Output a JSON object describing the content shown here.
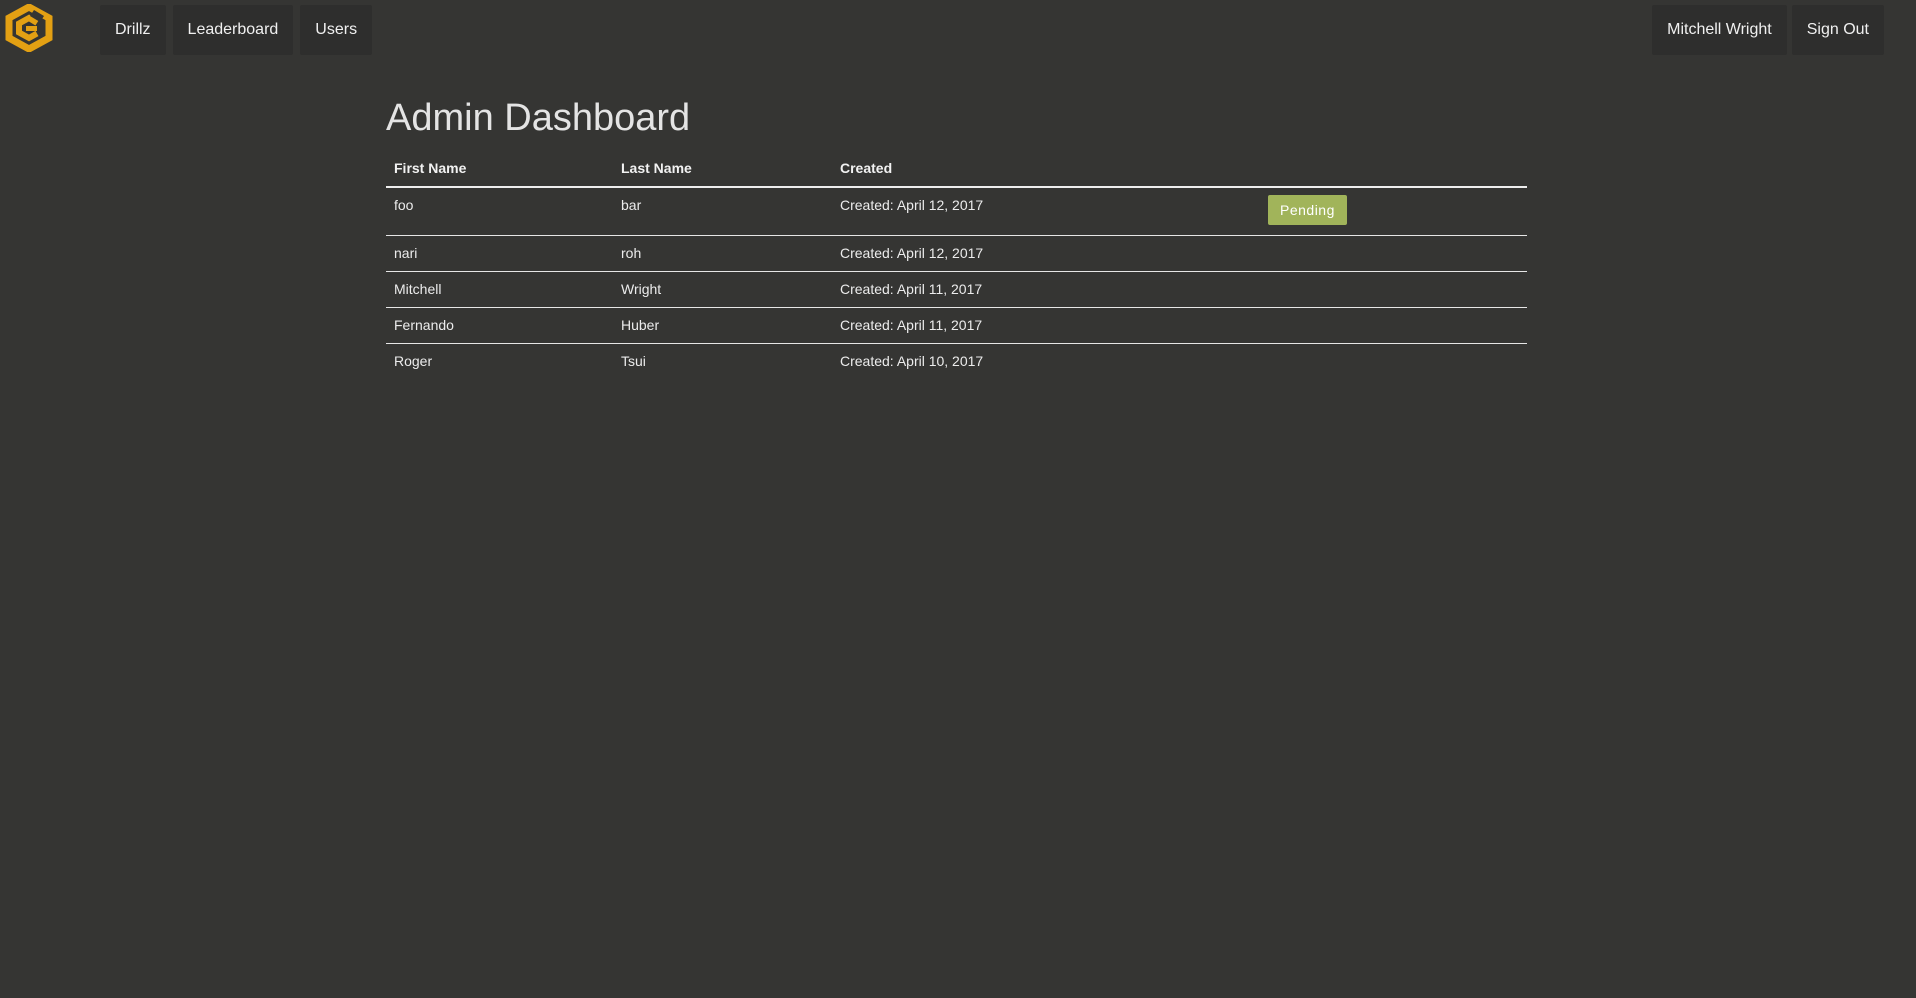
{
  "brand": {
    "logo_icon": "hexagon-logo-icon",
    "accent_color": "#e3a013"
  },
  "nav": {
    "left": [
      {
        "label": "Drillz"
      },
      {
        "label": "Leaderboard"
      },
      {
        "label": "Users"
      }
    ],
    "right": {
      "user_name": "Mitchell Wright",
      "sign_out": "Sign Out"
    }
  },
  "page": {
    "title": "Admin Dashboard"
  },
  "table": {
    "headers": {
      "first_name": "First Name",
      "last_name": "Last Name",
      "created": "Created",
      "status": ""
    },
    "rows": [
      {
        "first": "foo",
        "last": "bar",
        "created": "Created: April 12, 2017",
        "status": "Pending"
      },
      {
        "first": "nari",
        "last": "roh",
        "created": "Created: April 12, 2017",
        "status": ""
      },
      {
        "first": "Mitchell",
        "last": "Wright",
        "created": "Created: April 11, 2017",
        "status": ""
      },
      {
        "first": "Fernando",
        "last": "Huber",
        "created": "Created: April 11, 2017",
        "status": ""
      },
      {
        "first": "Roger",
        "last": "Tsui",
        "created": "Created: April 10, 2017",
        "status": ""
      }
    ]
  },
  "colors": {
    "background": "#353533",
    "nav_button": "#2e2e2d",
    "pending": "#a1b45a"
  }
}
